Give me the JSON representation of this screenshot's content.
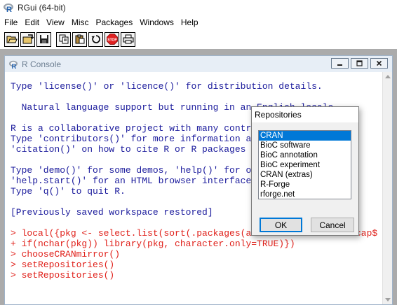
{
  "app": {
    "title": "RGui (64-bit)"
  },
  "menubar": {
    "items": [
      "File",
      "Edit",
      "View",
      "Misc",
      "Packages",
      "Windows",
      "Help"
    ]
  },
  "toolbar": {
    "buttons": [
      "open-script-icon",
      "load-workspace-icon",
      "save-workspace-icon",
      "copy-icon",
      "paste-icon",
      "copy-paste-icon",
      "stop-icon",
      "print-icon"
    ],
    "stop_label": "STOP"
  },
  "console": {
    "title": "R Console",
    "lines": [
      "Type 'license()' or 'licence()' for distribution details.",
      "",
      "  Natural language support but running in an English locale",
      "",
      "R is a collaborative project with many contribu",
      "Type 'contributors()' for more information and",
      "'citation()' on how to cite R or R packages in",
      "",
      "Type 'demo()' for some demos, 'help()' for on-l",
      "'help.start()' for an HTML browser interface to",
      "Type 'q()' to quit R.",
      "",
      "[Previously saved workspace restored]",
      "",
      "> local({pkg <- select.list(sort(.packages(all.",
      "+ if(nchar(pkg)) library(pkg, character.only=TRUE)})",
      "> chooseCRANmirror()",
      "> setRepositories()",
      "> setRepositories()"
    ],
    "line_tail": "cap$",
    "colors": {
      "output": "#1a1a9c",
      "input": "#e0201a"
    }
  },
  "dialog": {
    "title": "Repositories",
    "items": [
      "CRAN",
      "BioC software",
      "BioC annotation",
      "BioC experiment",
      "CRAN (extras)",
      "R-Forge",
      "rforge.net"
    ],
    "selected": "CRAN",
    "ok_label": "OK",
    "cancel_label": "Cancel"
  }
}
